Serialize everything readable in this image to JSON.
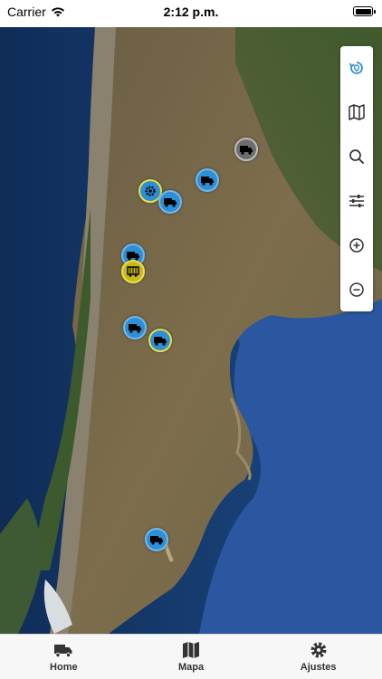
{
  "status_bar": {
    "carrier": "Carrier",
    "time": "2:12 p.m.",
    "icons": [
      "wifi-icon",
      "battery-icon"
    ]
  },
  "map": {
    "markers": [
      {
        "name": "truck-marker-north-east",
        "color": "#6d6d6d",
        "icon": "truck-icon"
      },
      {
        "name": "truck-marker-north-1",
        "color": "#2e8fd6",
        "icon": "truck-icon"
      },
      {
        "name": "settings-marker",
        "color": "#2e8fd6",
        "icon": "gear-icon"
      },
      {
        "name": "truck-marker-north-2",
        "color": "#2e8fd6",
        "icon": "truck-icon"
      },
      {
        "name": "truck-marker-center",
        "color": "#2e8fd6",
        "icon": "truck-icon"
      },
      {
        "name": "trailer-marker",
        "color": "#c9b81a",
        "icon": "trailer-icon"
      },
      {
        "name": "truck-cluster-marker-1",
        "color": "#2e8fd6",
        "icon": "truck-icon"
      },
      {
        "name": "truck-cluster-marker-2",
        "color": "#2e8fd6",
        "icon": "truck-icon"
      },
      {
        "name": "truck-marker-south",
        "color": "#2e8fd6",
        "icon": "truck-icon"
      }
    ]
  },
  "controls": [
    {
      "name": "refresh-location-button",
      "icon": "refresh-location-icon",
      "accent": "#2e8fd6"
    },
    {
      "name": "map-type-button",
      "icon": "map-icon"
    },
    {
      "name": "search-button",
      "icon": "search-icon"
    },
    {
      "name": "filter-button",
      "icon": "sliders-icon"
    },
    {
      "name": "zoom-in-button",
      "icon": "zoom-in-icon"
    },
    {
      "name": "zoom-out-button",
      "icon": "zoom-out-icon"
    }
  ],
  "tabs": [
    {
      "label": "Home",
      "icon": "truck-icon"
    },
    {
      "label": "Mapa",
      "icon": "map-icon"
    },
    {
      "label": "Ajustes",
      "icon": "gear-icon"
    }
  ]
}
